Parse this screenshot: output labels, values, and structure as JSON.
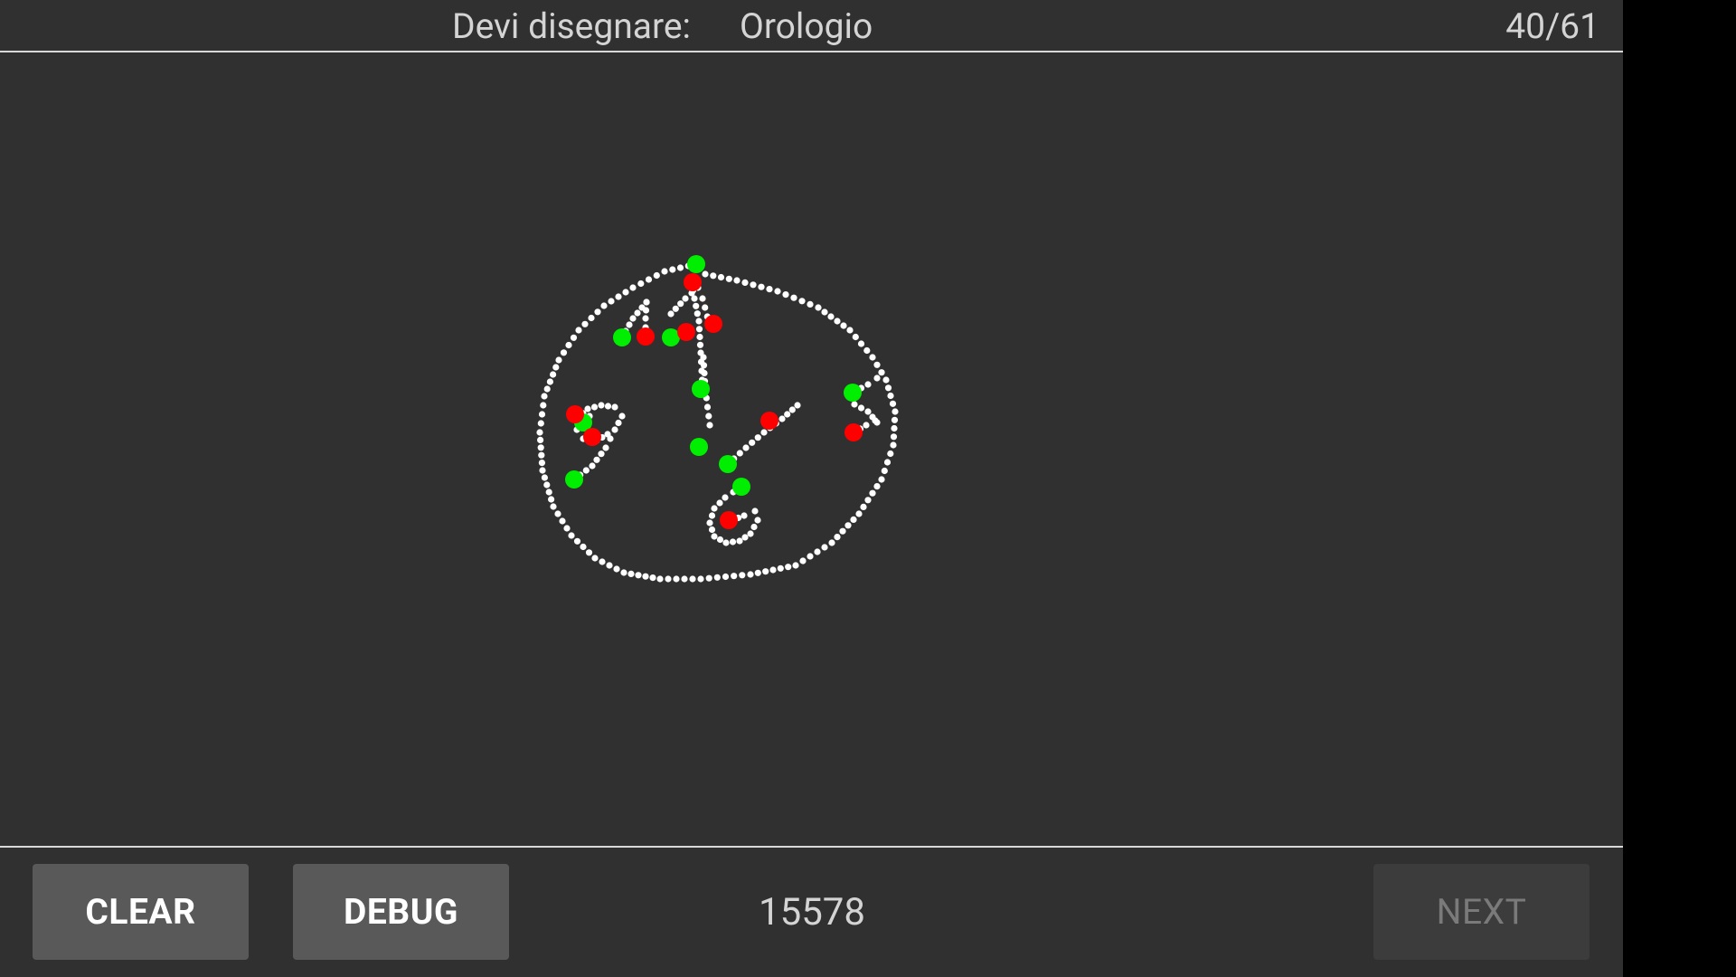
{
  "header": {
    "prompt_label": "Devi disegnare:",
    "word": "Orologio",
    "counter": "40/61"
  },
  "footer": {
    "clear_label": "CLEAR",
    "debug_label": "DEBUG",
    "score": "15578",
    "next_label": "NEXT"
  },
  "drawing": {
    "dot_color": "#ffffff",
    "start_marker_color": "#00ee00",
    "end_marker_color": "#ff0000"
  },
  "colors": {
    "background": "#303030",
    "button_bg": "#595959",
    "button_disabled_bg": "#3c3c3c",
    "text": "#d4d4d4"
  }
}
